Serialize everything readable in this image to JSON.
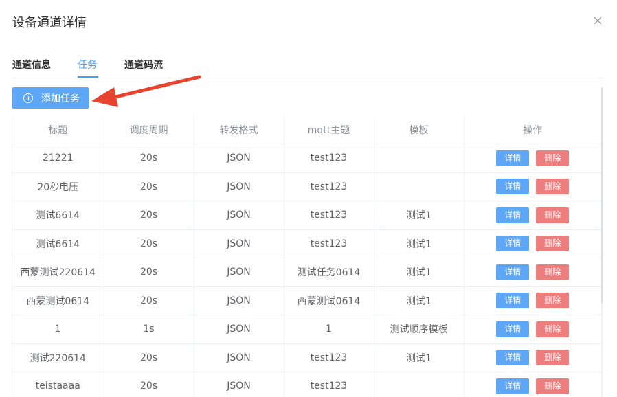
{
  "dialog": {
    "title": "设备通道详情"
  },
  "tabs": [
    {
      "label": "通道信息"
    },
    {
      "label": "任务"
    },
    {
      "label": "通道码流"
    }
  ],
  "toolbar": {
    "add_task_label": "添加任务"
  },
  "table": {
    "columns": [
      "标题",
      "调度周期",
      "转发格式",
      "mqtt主题",
      "模板",
      "操作"
    ],
    "detail_label": "详情",
    "delete_label": "删除",
    "rows": [
      {
        "title": "21221",
        "period": "20s",
        "format": "JSON",
        "topic": "test123",
        "template": ""
      },
      {
        "title": "20秒电压",
        "period": "20s",
        "format": "JSON",
        "topic": "test123",
        "template": ""
      },
      {
        "title": "测试6614",
        "period": "20s",
        "format": "JSON",
        "topic": "test123",
        "template": "测试1"
      },
      {
        "title": "测试6614",
        "period": "20s",
        "format": "JSON",
        "topic": "test123",
        "template": "测试1"
      },
      {
        "title": "西蒙测试220614",
        "period": "20s",
        "format": "JSON",
        "topic": "测试任务0614",
        "template": "测试1"
      },
      {
        "title": "西蒙测试0614",
        "period": "20s",
        "format": "JSON",
        "topic": "西蒙测试0614",
        "template": "测试1"
      },
      {
        "title": "1",
        "period": "1s",
        "format": "JSON",
        "topic": "1",
        "template": "测试顺序模板"
      },
      {
        "title": "测试220614",
        "period": "20s",
        "format": "JSON",
        "topic": "test123",
        "template": "测试1"
      },
      {
        "title": "teistaaaa",
        "period": "20s",
        "format": "JSON",
        "topic": "test123",
        "template": ""
      }
    ]
  },
  "colors": {
    "primary": "#409eff",
    "button_primary": "#5ea7f7",
    "button_danger": "#ec7e7e",
    "arrow": "#e8432e"
  }
}
